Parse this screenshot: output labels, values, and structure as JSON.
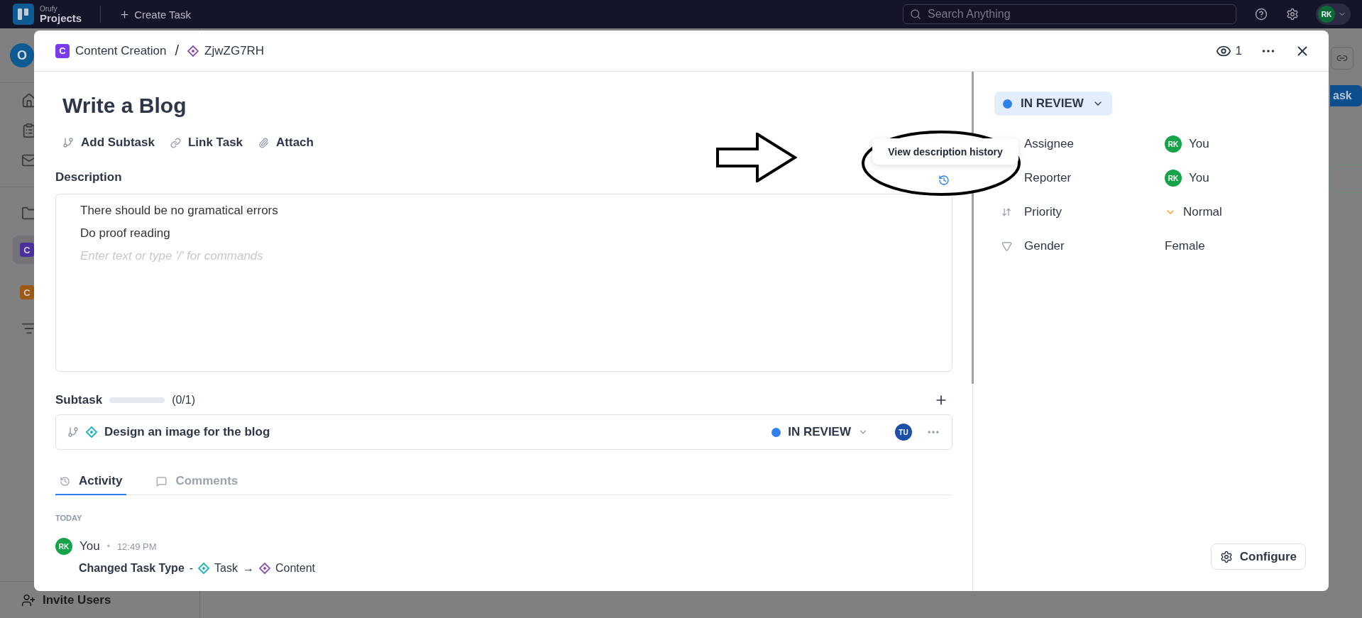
{
  "top_bar": {
    "logo_small": "Orufy",
    "logo_large": "Projects",
    "create_button": "Create Task",
    "search": {
      "placeholder": "Search Anything"
    },
    "avatar": "RK"
  },
  "sidebar": {
    "workspace": "O",
    "items": [
      {
        "label": "C",
        "color": "#4b2f9c",
        "selected": true
      },
      {
        "label": "C",
        "color": "#9c5a12",
        "selected": false
      }
    ],
    "invite": "Invite Users"
  },
  "page": {
    "button_fragment": "ask"
  },
  "modal": {
    "breadcrumb": {
      "badge": "C",
      "project": "Content Creation",
      "separator": "/",
      "task_id": "ZjwZG7RH"
    },
    "watchers": "1",
    "title": "Write a Blog",
    "actions": [
      "Add Subtask",
      "Link Task",
      "Attach"
    ],
    "description": {
      "label": "Description",
      "lines": [
        "There should be no gramatical errors",
        "Do proof reading"
      ],
      "placeholder": "Enter text or type '/' for commands"
    },
    "tooltip": "View description history",
    "subtasks": {
      "label": "Subtask",
      "level": 0,
      "count": "(0/1)",
      "items": [
        {
          "title": "Design an image for the blog",
          "status": "IN REVIEW",
          "assignee": "TU"
        }
      ]
    },
    "tabs": [
      {
        "label": "Activity",
        "selected": true
      },
      {
        "label": "Comments",
        "selected": false
      }
    ],
    "activity": {
      "day": "TODAY",
      "entries": [
        {
          "avatar": "RK",
          "user": "You",
          "dot": "•",
          "time": "12:49 PM",
          "action": "Changed Task Type",
          "dash": "-",
          "from": "Task",
          "arrow": "→",
          "to": "Content"
        }
      ]
    },
    "details": {
      "status": "IN REVIEW",
      "fields": [
        {
          "kind": "user",
          "label": "Assignee",
          "avatar": "RK",
          "value": "You"
        },
        {
          "kind": "user",
          "label": "Reporter",
          "avatar": "RK",
          "value": "You"
        },
        {
          "kind": "priority",
          "label": "Priority",
          "value": "Normal"
        },
        {
          "kind": "text",
          "label": "Gender",
          "value": "Female"
        }
      ]
    },
    "configure": "Configure"
  }
}
